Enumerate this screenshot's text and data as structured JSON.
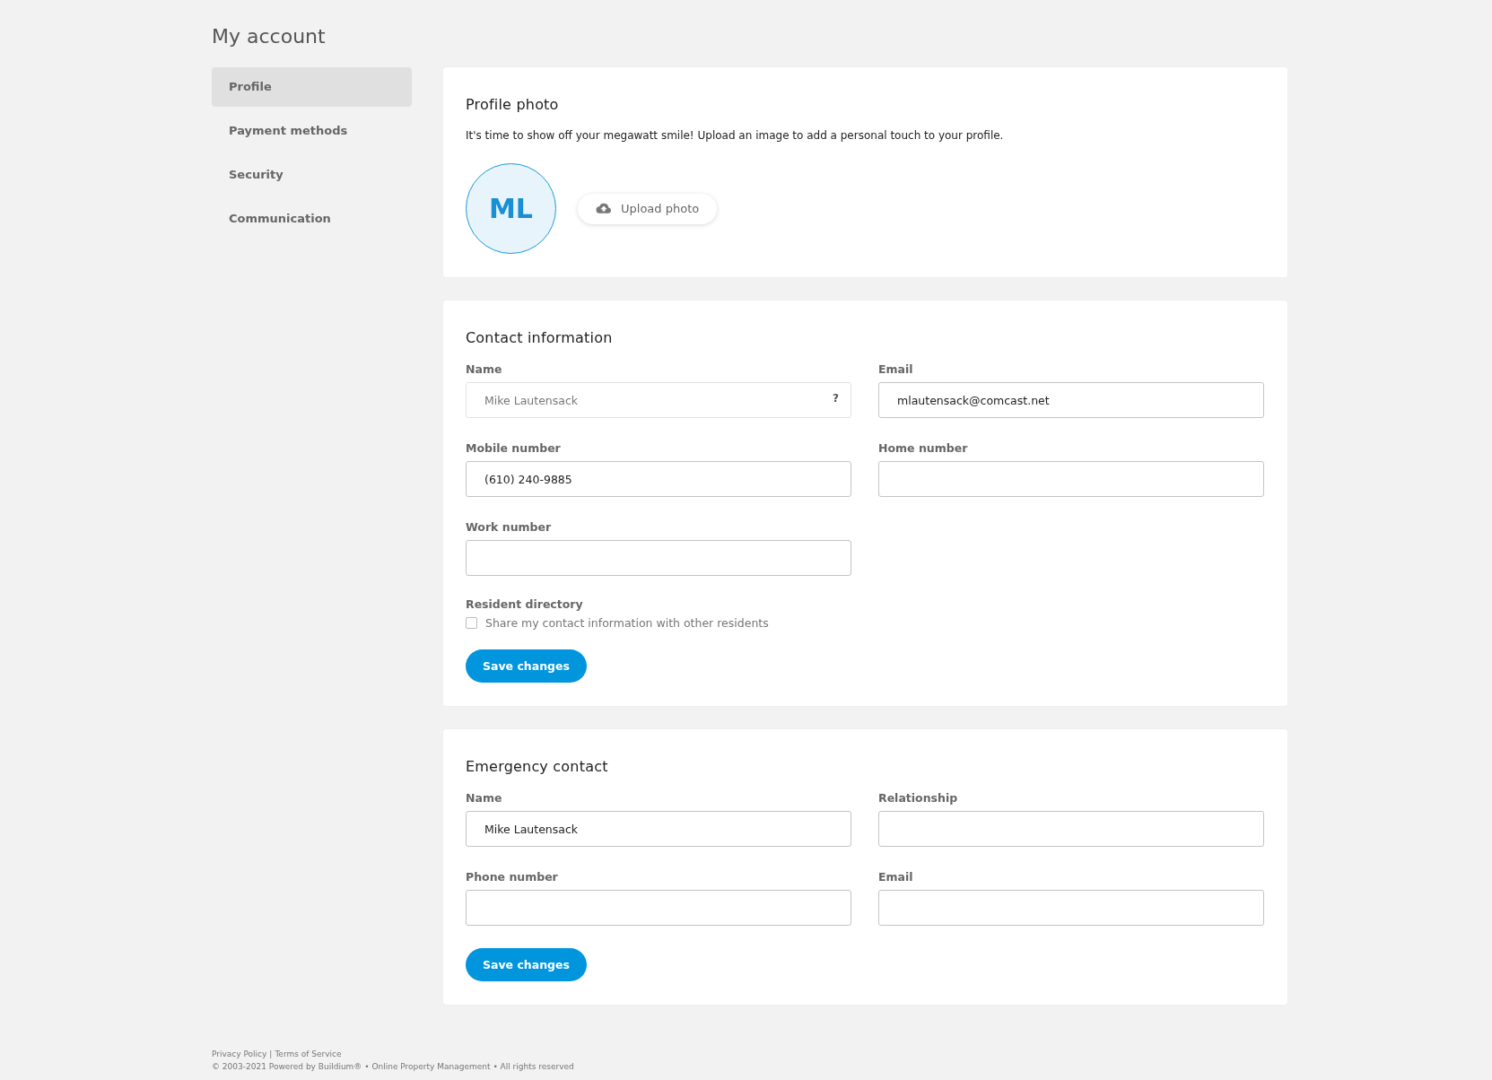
{
  "page_title": "My account",
  "sidebar": {
    "items": [
      {
        "label": "Profile",
        "selected": true
      },
      {
        "label": "Payment methods",
        "selected": false
      },
      {
        "label": "Security",
        "selected": false
      },
      {
        "label": "Communication",
        "selected": false
      }
    ]
  },
  "profile_photo": {
    "title": "Profile photo",
    "description": "It's time to show off your megawatt smile! Upload an image to add a personal touch to your profile.",
    "initials": "ML",
    "upload_button": "Upload photo"
  },
  "contact_information": {
    "title": "Contact information",
    "fields": [
      {
        "label": "Name",
        "value": "Mike Lautensack",
        "disabled": true,
        "help": "?"
      },
      {
        "label": "Email",
        "value": "mlautensack@comcast.net",
        "disabled": false
      },
      {
        "label": "Mobile number",
        "value": "(610) 240-9885",
        "disabled": false
      },
      {
        "label": "Home number",
        "disabled": false
      },
      {
        "label": "Work number",
        "disabled": false
      }
    ],
    "resident_directory": {
      "label": "Resident directory",
      "checkbox_label": "Share my contact information with other residents",
      "checked": false
    },
    "save_button": "Save changes"
  },
  "emergency_contact": {
    "title": "Emergency contact",
    "fields": [
      {
        "label": "Name",
        "value": "Mike Lautensack",
        "disabled": false
      },
      {
        "label": "Relationship",
        "disabled": false
      },
      {
        "label": "Phone number",
        "disabled": false
      },
      {
        "label": "Email",
        "disabled": false
      }
    ],
    "save_button": "Save changes"
  },
  "footer": {
    "links": [
      "Privacy Policy",
      "Terms of Service"
    ],
    "separator": "|",
    "copyright": "© 2003-2021 Powered by Buildium® • Online Property Management • All rights reserved"
  }
}
